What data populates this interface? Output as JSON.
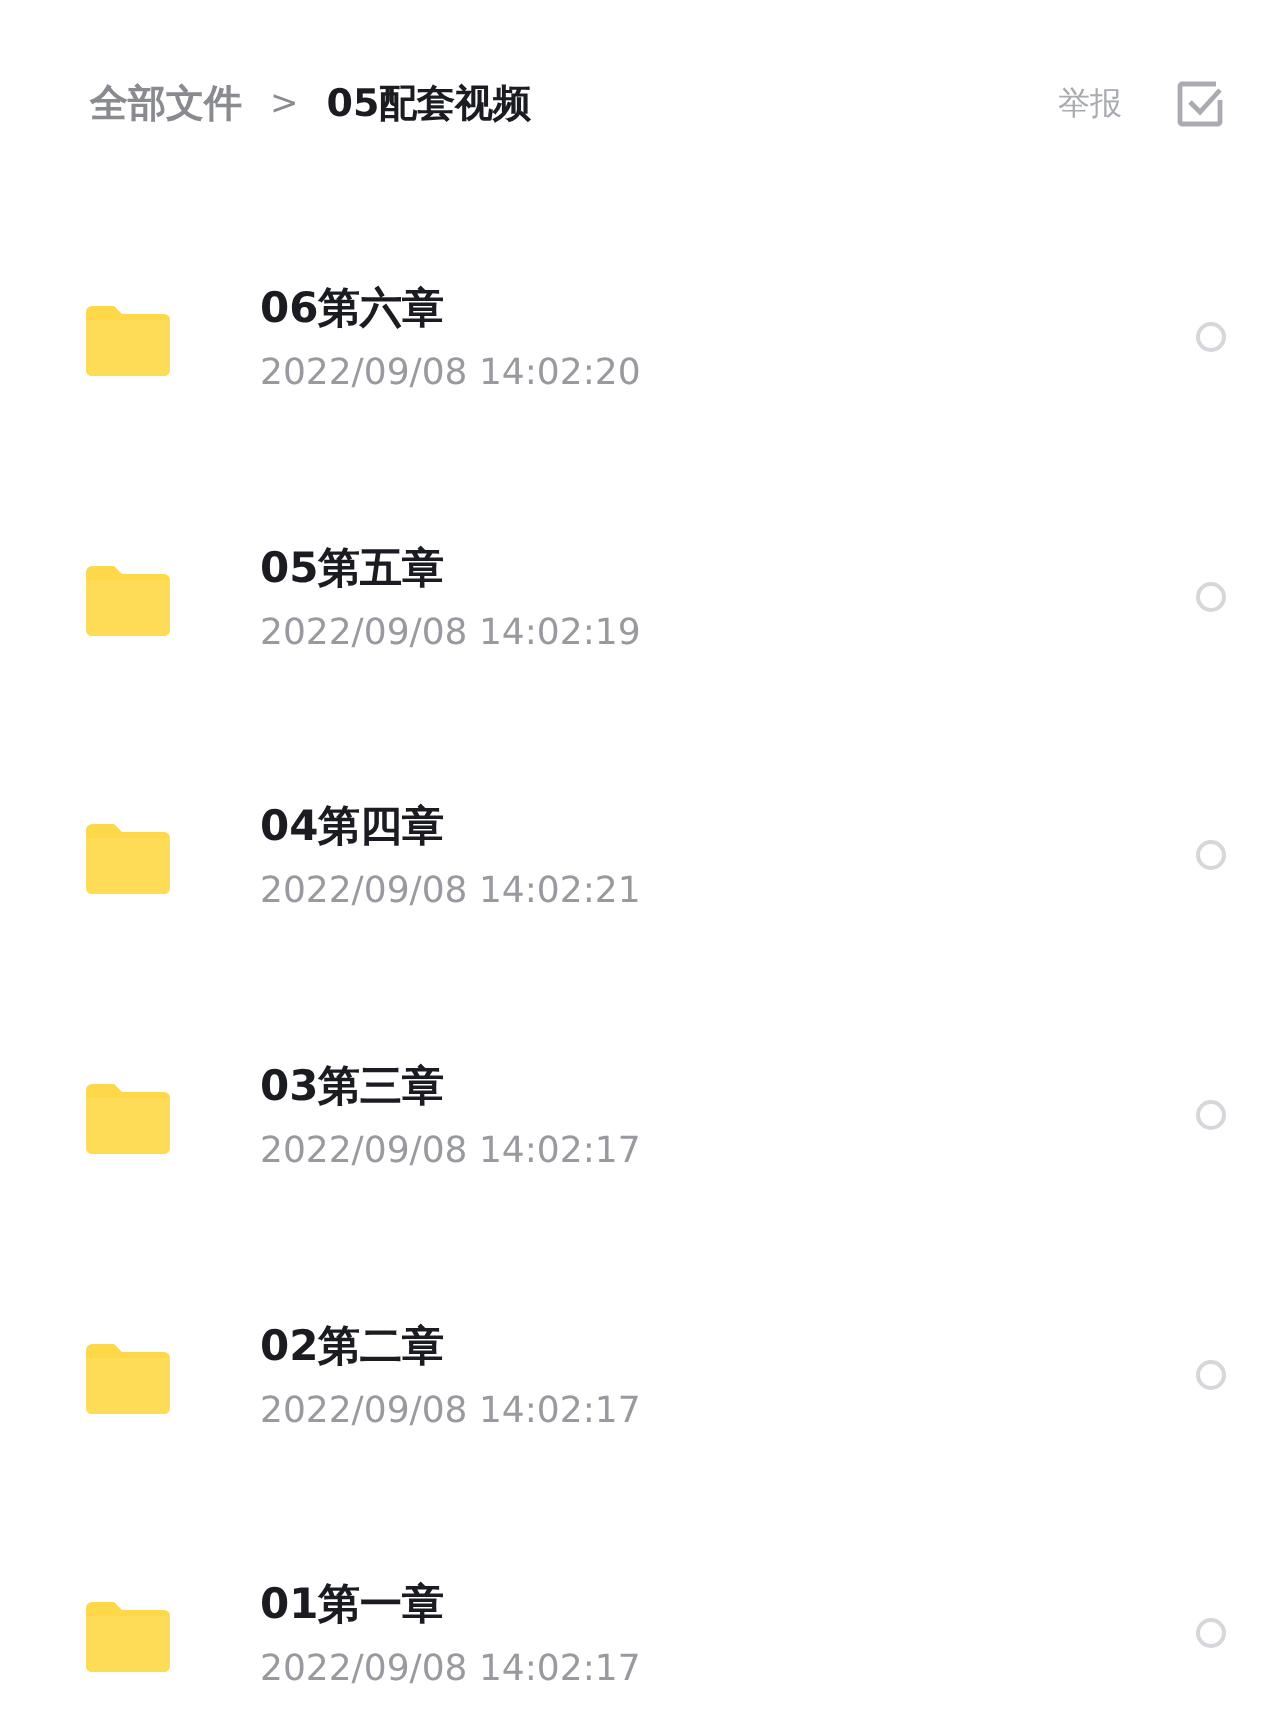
{
  "breadcrumb": {
    "root": "全部文件",
    "separator": ">",
    "current": "05配套视频"
  },
  "header_actions": {
    "report": "举报"
  },
  "files": [
    {
      "name": "06第六章",
      "date": "2022/09/08 14:02:20",
      "selected": false
    },
    {
      "name": "05第五章",
      "date": "2022/09/08 14:02:19",
      "selected": false
    },
    {
      "name": "04第四章",
      "date": "2022/09/08 14:02:21",
      "selected": false
    },
    {
      "name": "03第三章",
      "date": "2022/09/08 14:02:17",
      "selected": false
    },
    {
      "name": "02第二章",
      "date": "2022/09/08 14:02:17",
      "selected": false
    },
    {
      "name": "01第一章",
      "date": "2022/09/08 14:02:17",
      "selected": false
    }
  ]
}
